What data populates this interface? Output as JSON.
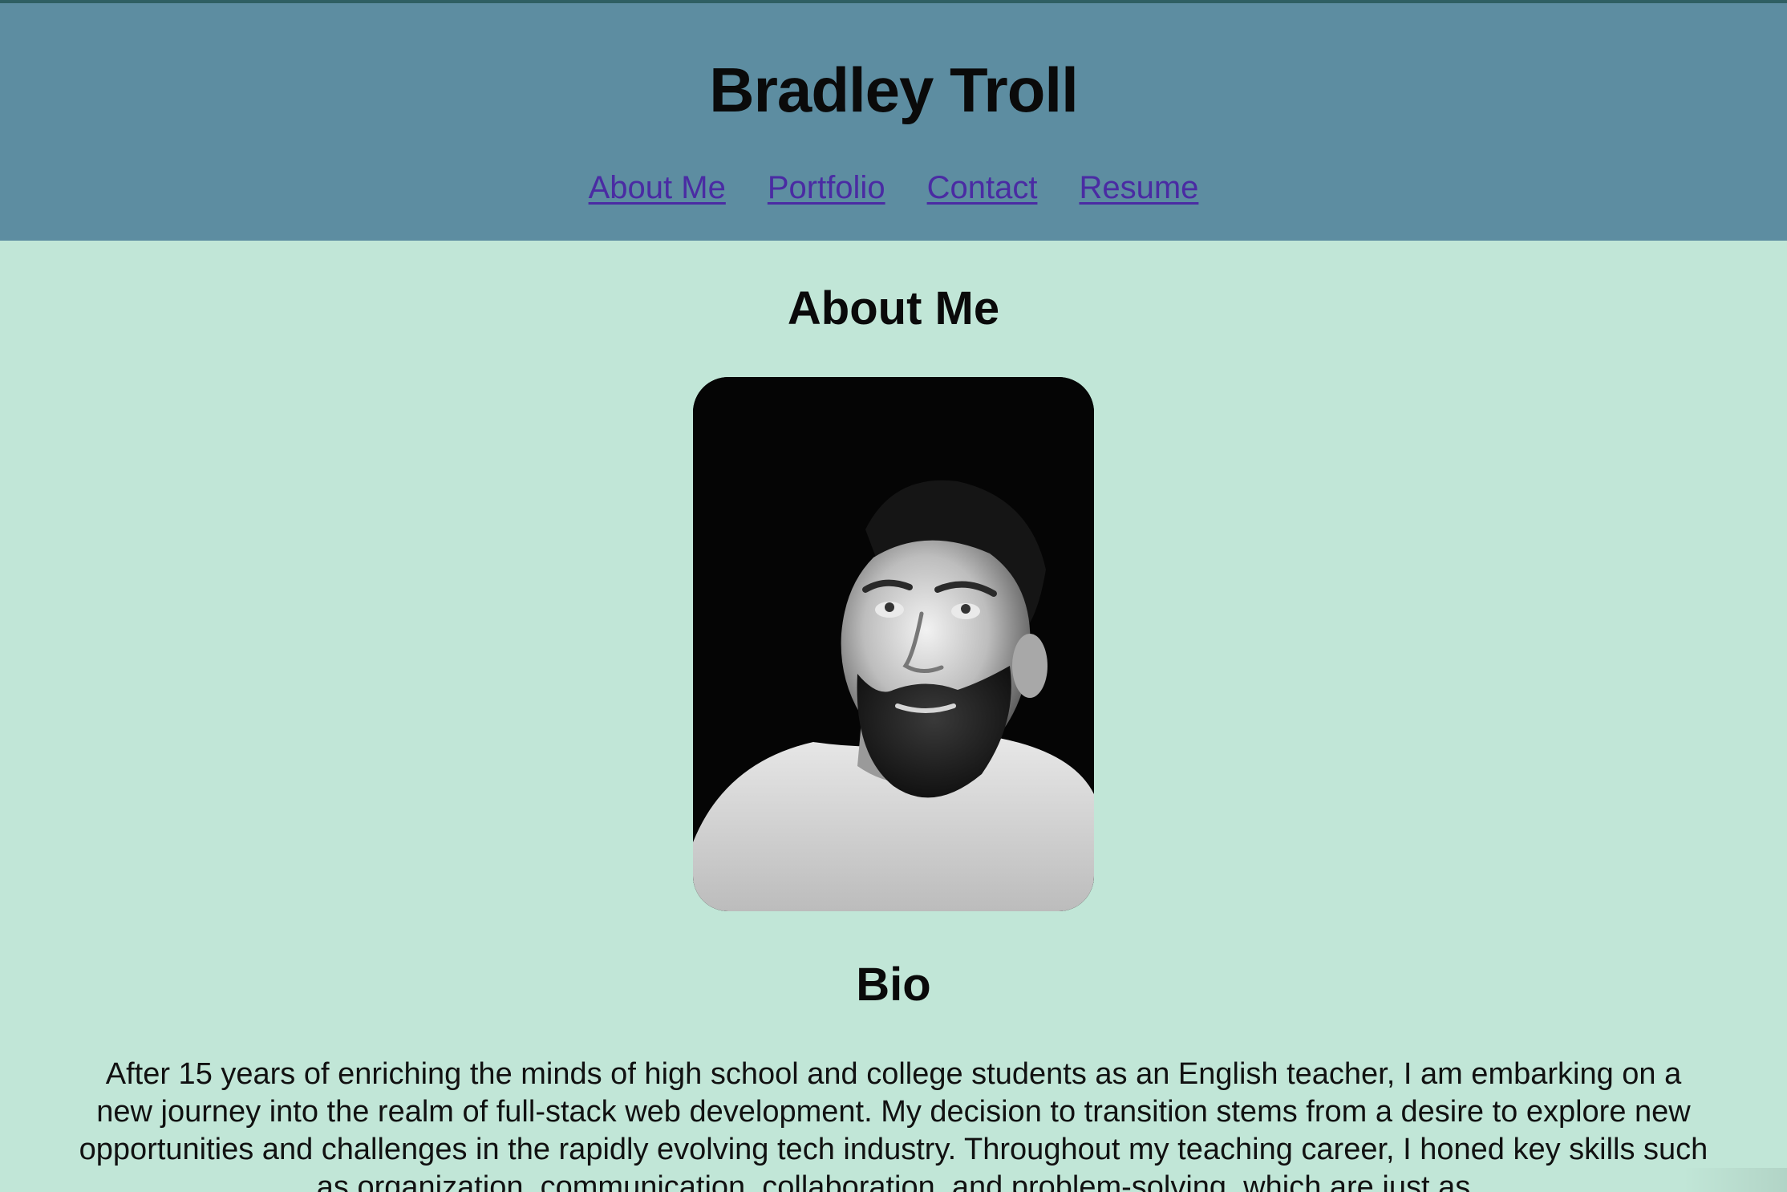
{
  "header": {
    "title": "Bradley Troll",
    "nav": [
      {
        "label": "About Me"
      },
      {
        "label": "Portfolio"
      },
      {
        "label": "Contact"
      },
      {
        "label": "Resume"
      }
    ]
  },
  "main": {
    "section_title": "About Me",
    "bio_title": "Bio",
    "bio_text": "After 15 years of enriching the minds of high school and college students as an English teacher, I am embarking on a new journey into the realm of full-stack web development. My decision to transition stems from a desire to explore new opportunities and challenges in the rapidly evolving tech industry. Throughout my teaching career, I honed key skills such as organization, communication, collaboration, and problem-solving, which are just as"
  },
  "colors": {
    "header_bg": "#5d8da1",
    "page_bg": "#c1e6d7",
    "link": "#4a2ba3"
  }
}
